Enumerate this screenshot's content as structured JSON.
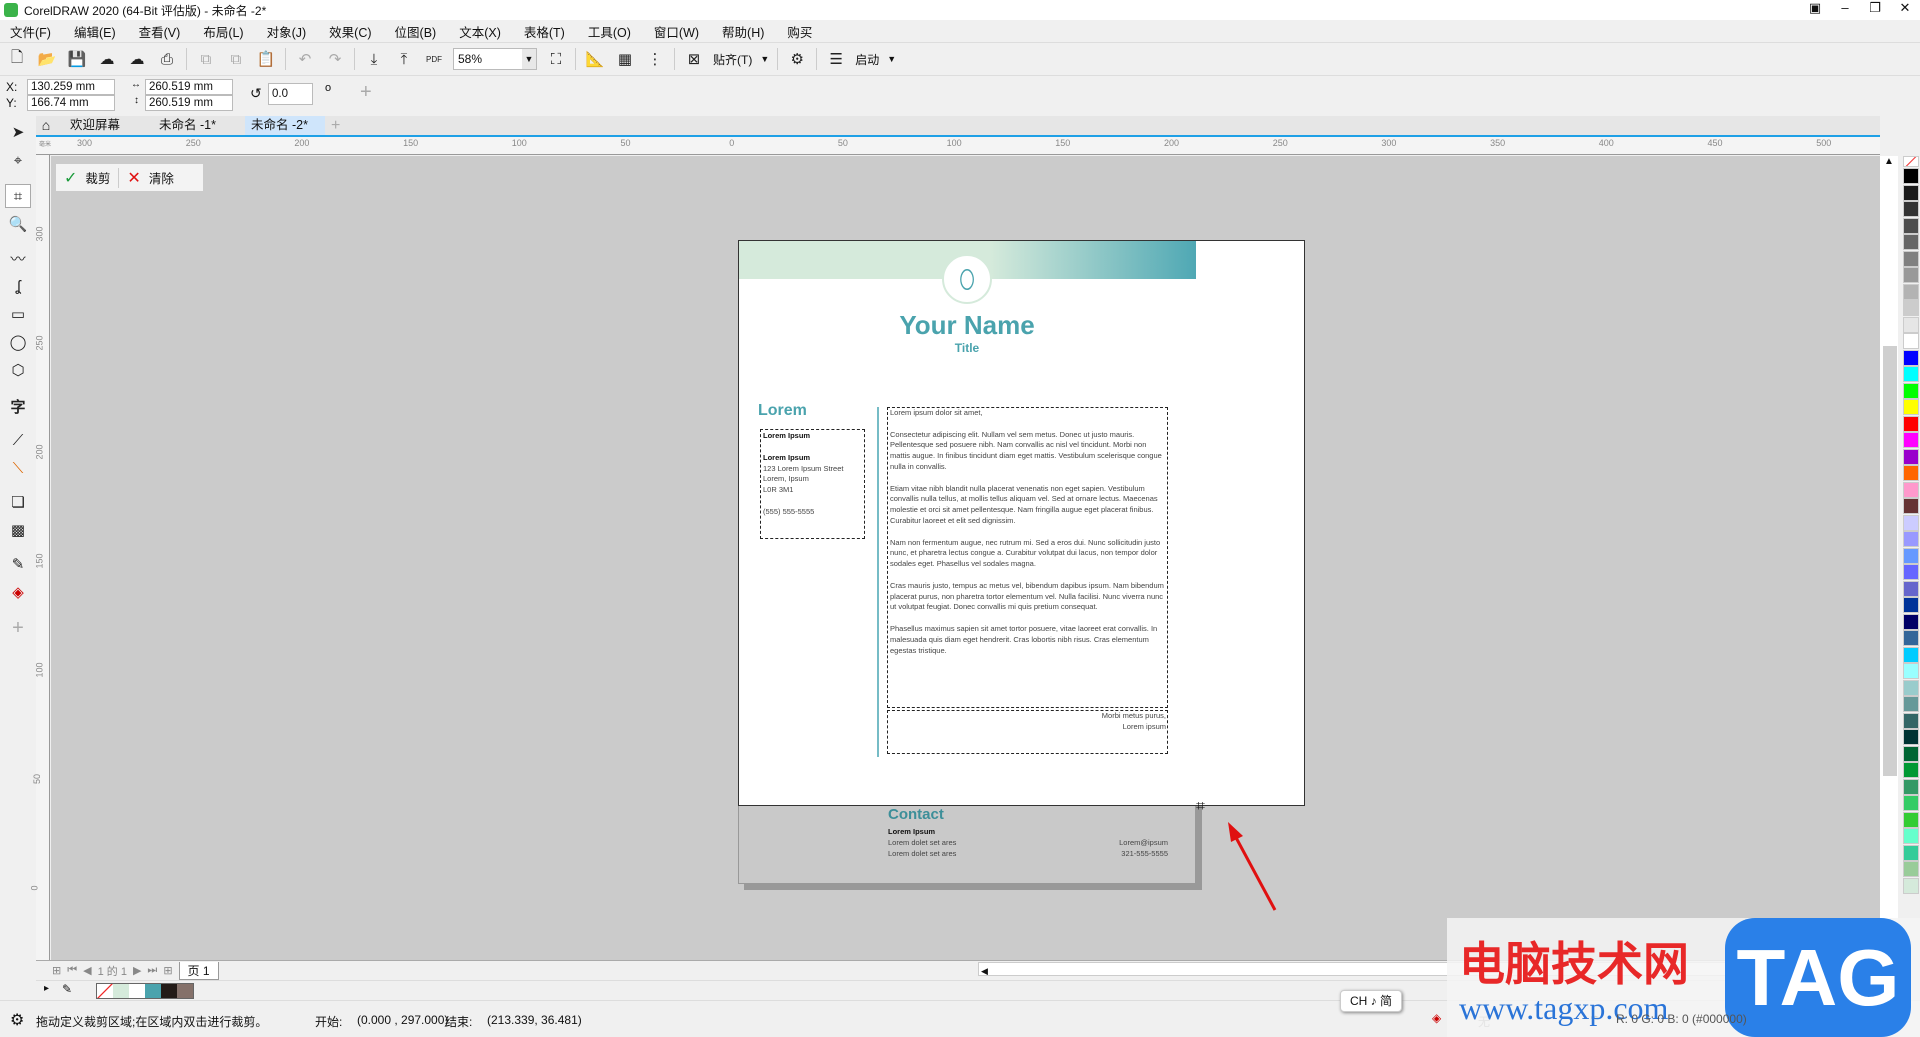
{
  "window": {
    "title": "CorelDRAW 2020 (64-Bit 评估版) - 未命名 -2*"
  },
  "menu": [
    "文件(F)",
    "编辑(E)",
    "查看(V)",
    "布局(L)",
    "对象(J)",
    "效果(C)",
    "位图(B)",
    "文本(X)",
    "表格(T)",
    "工具(O)",
    "窗口(W)",
    "帮助(H)",
    "购买"
  ],
  "toolbar": {
    "zoom": "58%",
    "snap_label": "贴齐(T)",
    "launch_label": "启动",
    "pdf_label": "PDF"
  },
  "props": {
    "x_label": "X:",
    "y_label": "Y:",
    "x": "130.259 mm",
    "y": "166.74 mm",
    "width": "260.519 mm",
    "height": "260.519 mm",
    "rotation": "0.0",
    "degree": "o"
  },
  "tabs": [
    "欢迎屏幕",
    "未命名 -1*",
    "未命名 -2*"
  ],
  "tab_add": "+",
  "ruler": {
    "top": [
      "300",
      "250",
      "200",
      "150",
      "100",
      "50",
      "0",
      "50",
      "100",
      "150",
      "200",
      "250",
      "300",
      "350",
      "400",
      "450",
      "500"
    ],
    "left": [
      "300",
      "250",
      "200",
      "150",
      "100",
      "50",
      "0"
    ],
    "unit": "毫米"
  },
  "crop": {
    "apply": "裁剪",
    "clear": "清除"
  },
  "resume": {
    "name": "Your Name",
    "title": "Title",
    "section": "Lorem",
    "left_lines": [
      "Lorem Ipsum",
      "",
      "Lorem Ipsum",
      "123 Lorem Ipsum Street",
      "Lorem, Ipsum",
      "L0R 3M1",
      "",
      "(555) 555-5555"
    ],
    "paragraphs": [
      "Lorem ipsum dolor sit amet,",
      "Consectetur adipiscing elit. Nullam vel sem metus. Donec ut justo mauris. Pellentesque sed posuere nibh. Nam convallis ac nisl vel tincidunt. Morbi non mattis augue. In finibus tincidunt diam eget mattis. Vestibulum scelerisque congue nulla in convallis.",
      "Etiam vitae nibh blandit nulla placerat venenatis non eget sapien. Vestibulum convallis nulla tellus, at mollis tellus aliquam vel. Sed at ornare lectus. Maecenas molestie et orci sit amet pellentesque. Nam fringilla augue eget placerat finibus. Curabitur laoreet et elit sed dignissim.",
      "Nam non fermentum augue, nec rutrum mi. Sed a eros dui. Nunc sollicitudin justo nunc, et pharetra lectus congue a. Curabitur volutpat dui lacus, non tempor dolor sodales eget. Phasellus vel sodales magna.",
      "Cras mauris justo, tempus ac metus vel, bibendum dapibus ipsum. Nam bibendum placerat purus, non pharetra tortor elementum vel. Nulla facilisi. Nunc viverra nunc ut volutpat feugiat. Donec convallis mi quis pretium consequat.",
      "Phasellus maximus sapien sit amet tortor posuere, vitae laoreet erat convallis. In malesuada quis diam eget hendrerit. Cras lobortis nibh risus. Cras elementum egestas tristique."
    ],
    "signoff": [
      "Morbi metus purus,",
      "Lorem ipsum"
    ],
    "contact": {
      "heading": "Contact",
      "name": "Lorem Ipsum",
      "addr1": "Lorem dolet set ares",
      "addr2": "Lorem dolet set ares",
      "email": "Lorem@ipsum",
      "phone": "321-555-5555"
    }
  },
  "pagenav": {
    "counter": "1 的 1",
    "page_tab": "页 1"
  },
  "status": {
    "hint": "拖动定义裁剪区域;在区域内双击进行裁剪。",
    "start_label": "开始:",
    "start": "(0.000 , 297.000)",
    "end_label": "结束:",
    "end": "(213.339, 36.481)",
    "fill": "无",
    "color_readout": "R: 0 G: 0 B: 0 (#000000)"
  },
  "ime": "CH ♪ 简",
  "watermark": {
    "cn": "电脑技术网",
    "url": "www.tagxp.com",
    "tag": "TAG"
  },
  "colors": {
    "accent": "#4aa3ad",
    "band_start": "#d5eadb",
    "band_end": "#4fa8b4"
  },
  "doc_palette": [
    "#d5eadb",
    "#ffffff",
    "#4aa3ad",
    "#231b17",
    "#85716a"
  ],
  "palette": [
    "#000000",
    "#1a1a1a",
    "#333333",
    "#4d4d4d",
    "#666666",
    "#808080",
    "#999999",
    "#b3b3b3",
    "#cccccc",
    "#e6e6e6",
    "#ffffff",
    "#0000ff",
    "#00ffff",
    "#00ff00",
    "#ffff00",
    "#ff0000",
    "#ff00ff",
    "#9900cc",
    "#ff6600",
    "#ff99cc",
    "#663333",
    "#ccccff",
    "#9999ff",
    "#6699ff",
    "#6666ff",
    "#6666cc",
    "#003399",
    "#000066",
    "#336699",
    "#00ccff",
    "#99ffff",
    "#99cccc",
    "#669999",
    "#336666",
    "#003333",
    "#006633",
    "#009933",
    "#339966",
    "#33cc66",
    "#33cc33",
    "#66ffcc",
    "#33cc99",
    "#99cc99",
    "#d5eadb"
  ]
}
